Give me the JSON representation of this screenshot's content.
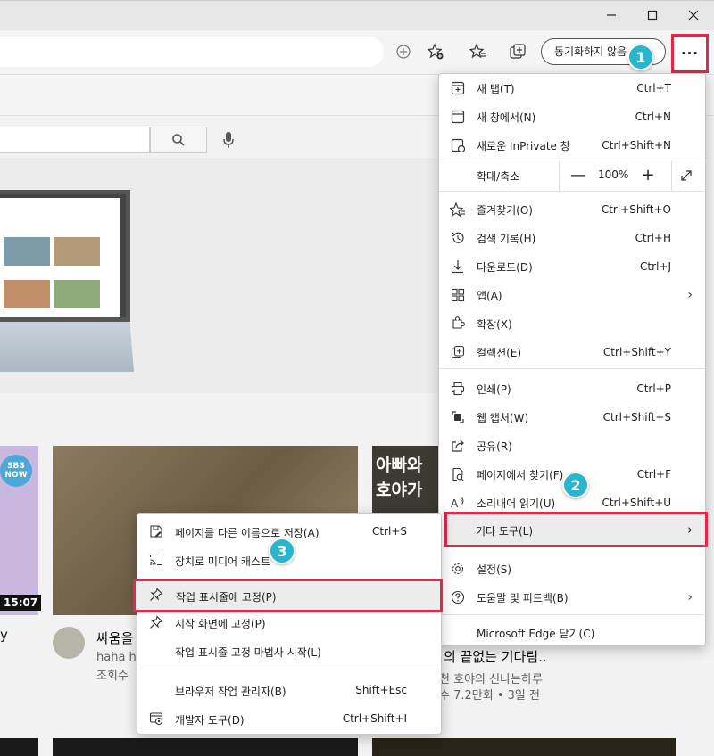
{
  "window": {
    "minimize_icon": "minimize-icon",
    "maximize_icon": "maximize-icon",
    "close_icon": "close-icon"
  },
  "toolbar": {
    "sync_label": "동기화하지 않음",
    "more_label": "···"
  },
  "page": {
    "video1_badge": "SBS NOW",
    "video1_duration": "15:07",
    "video3_text": "아빠와 호야가",
    "video2_title": "싸움을",
    "video2_sub1": "haha ha",
    "video2_sub2": "조회수",
    "video3_title": "의 끝없는 기다림..",
    "video3_channel": "천 호야의 신나는하루",
    "video3_views": "수 7.2만회 • 3일 전",
    "left_partial_text": "y"
  },
  "menu": {
    "new_tab": {
      "label": "새 탭(T)",
      "shortcut": "Ctrl+T"
    },
    "new_window": {
      "label": "새 창에서(N)",
      "shortcut": "Ctrl+N"
    },
    "new_inprivate": {
      "label": "새로운 InPrivate 창",
      "shortcut": "Ctrl+Shift+N"
    },
    "zoom": {
      "label": "확대/축소",
      "value": "100%",
      "minus": "—",
      "plus": "+"
    },
    "favorites": {
      "label": "즐겨찾기(O)",
      "shortcut": "Ctrl+Shift+O"
    },
    "history": {
      "label": "검색 기록(H)",
      "shortcut": "Ctrl+H"
    },
    "downloads": {
      "label": "다운로드(D)",
      "shortcut": "Ctrl+J"
    },
    "apps": {
      "label": "앱(A)"
    },
    "extensions": {
      "label": "확장(X)"
    },
    "collections": {
      "label": "컬렉션(E)",
      "shortcut": "Ctrl+Shift+Y"
    },
    "print": {
      "label": "인쇄(P)",
      "shortcut": "Ctrl+P"
    },
    "web_capture": {
      "label": "웹 캡처(W)",
      "shortcut": "Ctrl+Shift+S"
    },
    "share": {
      "label": "공유(R)"
    },
    "find": {
      "label": "페이지에서 찾기(F)",
      "shortcut": "Ctrl+F"
    },
    "read_aloud": {
      "label": "소리내어 읽기(U)",
      "shortcut": "Ctrl+Shift+U"
    },
    "more_tools": {
      "label": "기타 도구(L)"
    },
    "settings": {
      "label": "설정(S)"
    },
    "help": {
      "label": "도움말 및 피드백(B)"
    },
    "close_edge": {
      "label": "Microsoft Edge 닫기(C)"
    }
  },
  "submenu": {
    "save_as": {
      "label": "페이지를 다른 이름으로 저장(A)",
      "shortcut": "Ctrl+S"
    },
    "cast": {
      "label": "장치로 미디어 캐스트"
    },
    "pin_taskbar": {
      "label": "작업 표시줄에 고정(P)"
    },
    "pin_start": {
      "label": "시작 화면에 고정(P)"
    },
    "pin_wizard": {
      "label": "작업 표시줄 고정 마법사 시작(L)"
    },
    "task_manager": {
      "label": "브라우저 작업 관리자(B)",
      "shortcut": "Shift+Esc"
    },
    "dev_tools": {
      "label": "개발자 도구(D)",
      "shortcut": "Ctrl+Shift+I"
    }
  },
  "callouts": [
    "1",
    "2",
    "3"
  ],
  "colors": {
    "highlight": "#e0294b",
    "callout": "#27b6cc"
  }
}
